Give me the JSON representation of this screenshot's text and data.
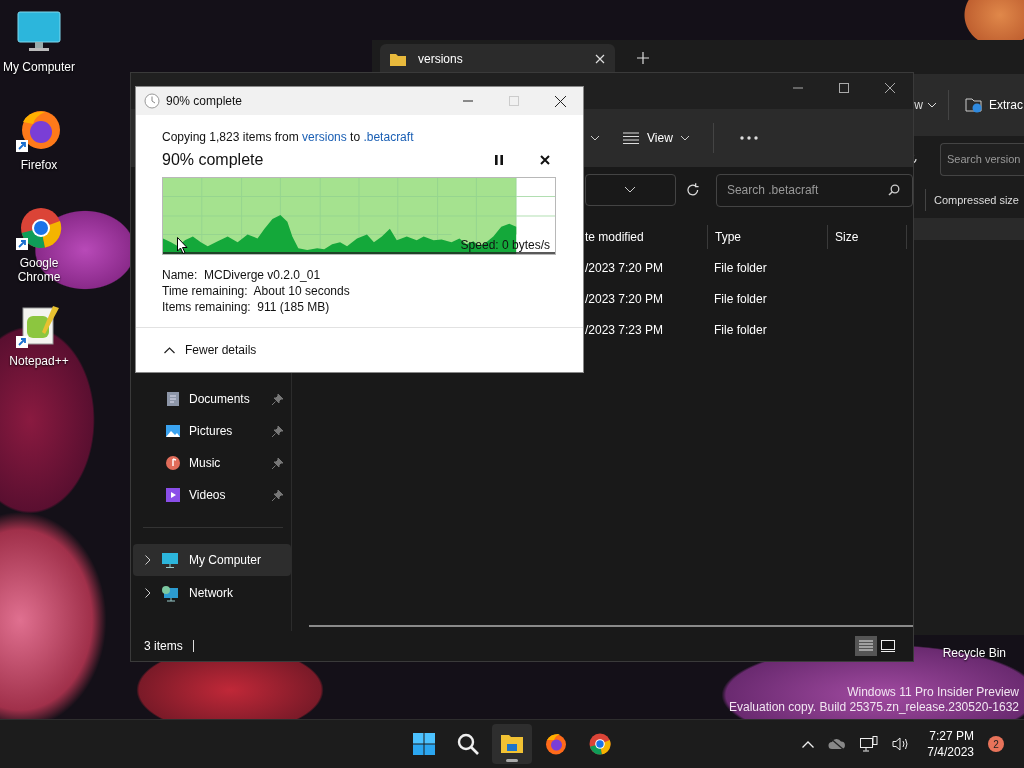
{
  "desktop": {
    "icons": [
      {
        "label": "My Computer",
        "kind": "computer",
        "shortcut": false
      },
      {
        "label": "Firefox",
        "kind": "firefox",
        "shortcut": true
      },
      {
        "label": "Google Chrome",
        "kind": "chrome",
        "shortcut": true
      },
      {
        "label": "Notepad++",
        "kind": "notepad",
        "shortcut": true
      }
    ],
    "recycle_bin_label": "Recycle Bin",
    "watermark": [
      "Windows 11 Pro Insider Preview",
      "Evaluation copy. Build 25375.zn_release.230520-1632"
    ]
  },
  "back_window": {
    "tab": "versions",
    "partial_menu": "w",
    "extract_button": "Extrac",
    "search": {
      "placeholder": "Search version"
    },
    "column": "Compressed size"
  },
  "explorer": {
    "view_button": "View",
    "search": {
      "placeholder": "Search .betacraft"
    },
    "columns": [
      "te modified",
      "Type",
      "Size"
    ],
    "rows": [
      {
        "date_modified": "/2023 7:20 PM",
        "type": "File folder"
      },
      {
        "date_modified": "/2023 7:20 PM",
        "type": "File folder"
      },
      {
        "date_modified": "/2023 7:23 PM",
        "type": "File folder"
      }
    ],
    "quick_access": [
      {
        "label": "Documents",
        "kind": "documents",
        "pinned": true
      },
      {
        "label": "Pictures",
        "kind": "pictures",
        "pinned": true
      },
      {
        "label": "Music",
        "kind": "music",
        "pinned": true
      },
      {
        "label": "Videos",
        "kind": "videos",
        "pinned": true
      }
    ],
    "locations": [
      {
        "label": "My Computer",
        "kind": "computer",
        "selected": true
      },
      {
        "label": "Network",
        "kind": "network",
        "selected": false
      }
    ],
    "status": "3 items",
    "view_modes": [
      {
        "kind": "details",
        "selected": true
      },
      {
        "kind": "tiles",
        "selected": false
      }
    ]
  },
  "copy_dialog": {
    "title": "90% complete",
    "summary": {
      "prefix": "Copying 1,823 items from",
      "source": "versions",
      "joiner": "to",
      "destination": ".betacraft"
    },
    "heading": "90% complete",
    "progress": {
      "level": 0.9
    },
    "speed": "Speed: 0 bytes/s",
    "details": [
      "Name:  MCDiverge v0.2.0_01",
      "Time remaining:  About 10 seconds",
      "Items remaining:  911 (185 MB)"
    ],
    "toggle": "Fewer details"
  },
  "taskbar": {
    "apps": [
      {
        "kind": "start",
        "active": false
      },
      {
        "kind": "search",
        "active": false
      },
      {
        "kind": "explorer",
        "active": true
      },
      {
        "kind": "firefox",
        "active": false
      },
      {
        "kind": "chrome",
        "active": false
      }
    ],
    "time": "7:27 PM",
    "date": "7/4/2023",
    "notifications": "2"
  }
}
